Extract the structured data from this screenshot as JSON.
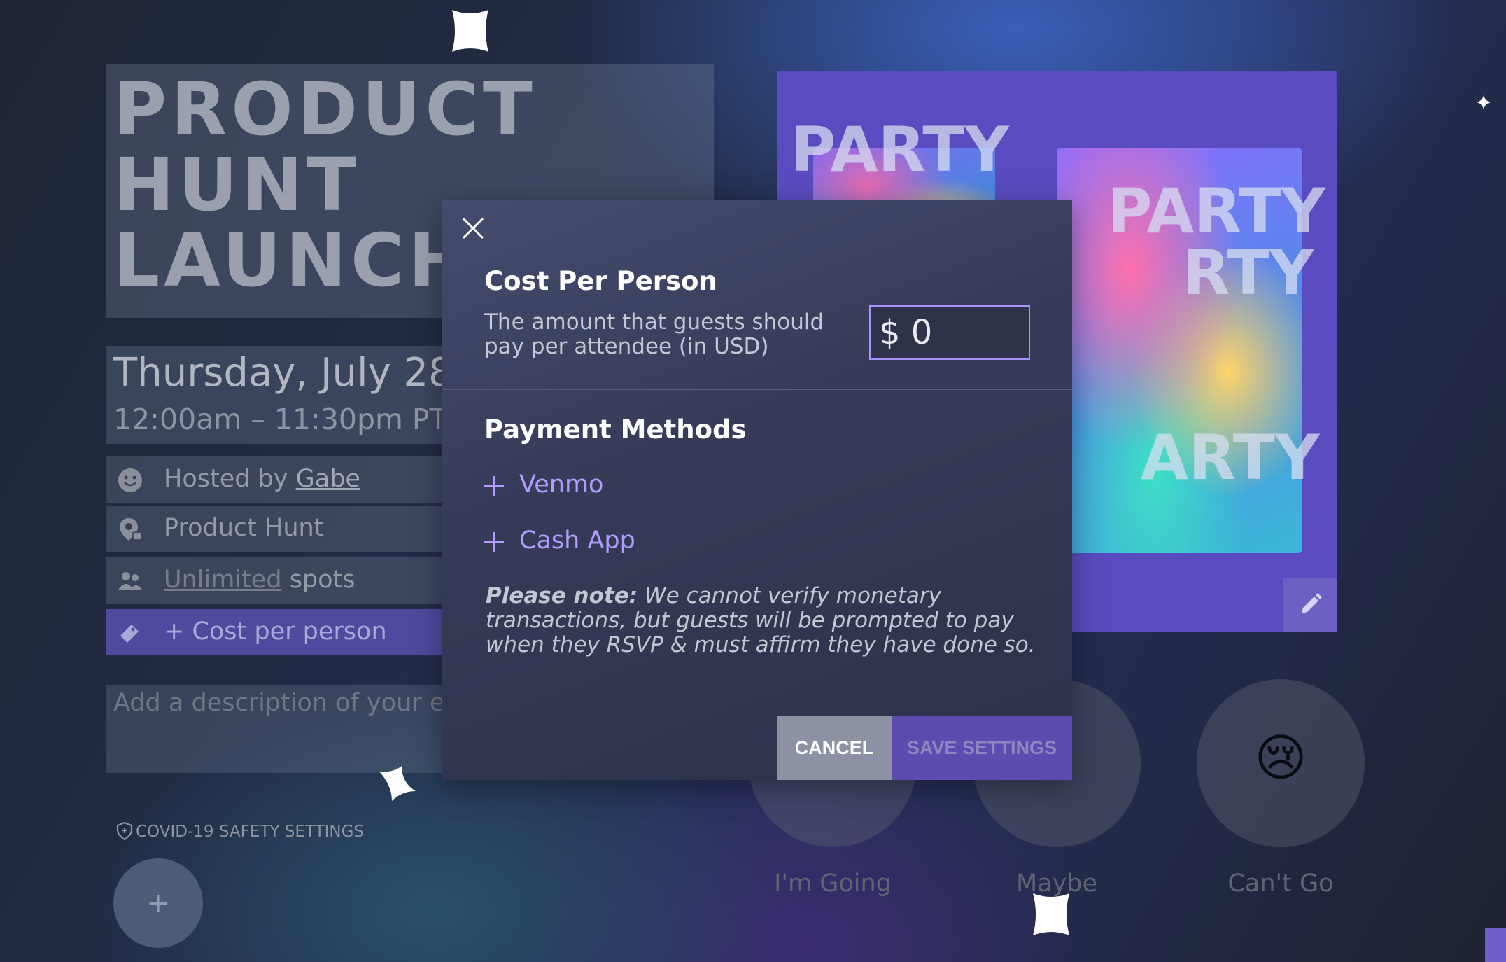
{
  "event": {
    "title": "PRODUCT\nHUNT\nLAUNCH",
    "date": "Thursday, July 28",
    "time": "12:00am – 11:30pm PT",
    "host_prefix": "Hosted by",
    "host_name": "Gabe",
    "location": "Product Hunt",
    "spots_link": "Unlimited",
    "spots_suffix": "spots",
    "cost_label": "+ Cost per person",
    "description_placeholder": "Add a description of your event",
    "covid_label": "COVID-19 SAFETY SETTINGS",
    "add_button": "+"
  },
  "poster": {
    "words": [
      "PARTY",
      "PARTY",
      "RTY",
      "ARTY"
    ]
  },
  "rsvp": {
    "going": "I'm Going",
    "maybe": "Maybe",
    "cant_go": "Can't Go",
    "cant_go_emoji": "😢"
  },
  "modal": {
    "cost_title": "Cost Per Person",
    "cost_description": "The amount that guests should pay per attendee (in USD)",
    "cost_value": "$ 0",
    "payment_title": "Payment Methods",
    "methods": [
      "Venmo",
      "Cash App"
    ],
    "note_bold": "Please note:",
    "note_text": " We cannot verify monetary transactions, but guests will be prompted to pay when they RSVP & must affirm they have done so.",
    "cancel_label": "CANCEL",
    "save_label": "SAVE SETTINGS"
  },
  "colors": {
    "accent": "#b29cff",
    "poster_bg": "#5a4cc0",
    "cost_row": "#4f4a9e"
  }
}
